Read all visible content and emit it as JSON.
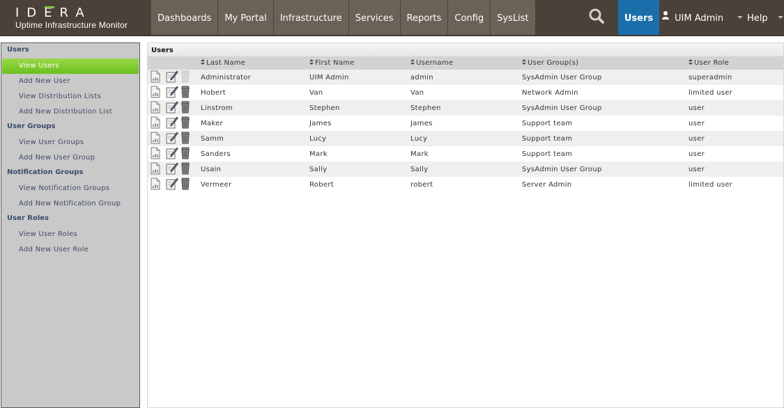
{
  "brand": {
    "logo": "IDERA",
    "subtitle": "Uptime Infrastructure Monitor"
  },
  "nav": [
    {
      "label": "Dashboards"
    },
    {
      "label": "My Portal"
    },
    {
      "label": "Infrastructure"
    },
    {
      "label": "Services"
    },
    {
      "label": "Reports"
    },
    {
      "label": "Config"
    },
    {
      "label": "SysList"
    }
  ],
  "header": {
    "search_icon": "search-icon",
    "users_label": "Users",
    "user_label": "UIM Admin",
    "help_label": "Help"
  },
  "sidebar": {
    "sections": [
      {
        "title": "Users",
        "items": [
          "View Users",
          "Add New User",
          "View Distribution Lists",
          "Add New Distribution List"
        ]
      },
      {
        "title": "User Groups",
        "items": [
          "View User Groups",
          "Add New User Group"
        ]
      },
      {
        "title": "Notification Groups",
        "items": [
          "View Notification Groups",
          "Add New Notification Group"
        ]
      },
      {
        "title": "User Roles",
        "items": [
          "View User Roles",
          "Add New User Role"
        ]
      }
    ],
    "active_item": "View Users"
  },
  "main": {
    "title": "Users",
    "columns": [
      "Last Name",
      "First Name",
      "Username",
      "User Group(s)",
      "User Role"
    ],
    "rows": [
      {
        "last": "Administrator",
        "first": "UIM Admin",
        "username": "admin",
        "group": "SysAdmin User Group",
        "role": "superadmin",
        "deletable": false
      },
      {
        "last": "Hobert",
        "first": "Van",
        "username": "Van",
        "group": "Network Admin",
        "role": "limited user",
        "deletable": true
      },
      {
        "last": "Linstrom",
        "first": "Stephen",
        "username": "Stephen",
        "group": "SysAdmin User Group",
        "role": "user",
        "deletable": true
      },
      {
        "last": "Maker",
        "first": "James",
        "username": "James",
        "group": "Support team",
        "role": "user",
        "deletable": true
      },
      {
        "last": "Samm",
        "first": "Lucy",
        "username": "Lucy",
        "group": "Support team",
        "role": "user",
        "deletable": true
      },
      {
        "last": "Sanders",
        "first": "Mark",
        "username": "Mark",
        "group": "Support team",
        "role": "user",
        "deletable": true
      },
      {
        "last": "Usain",
        "first": "Sally",
        "username": "Sally",
        "group": "SysAdmin User Group",
        "role": "user",
        "deletable": true
      },
      {
        "last": "Vermeer",
        "first": "Robert",
        "username": "robert",
        "group": "Server Admin",
        "role": "limited user",
        "deletable": true
      }
    ]
  },
  "colors": {
    "topbar": "#4a4138",
    "nav_item": "#6b6157",
    "users_active": "#1a6faa",
    "sidebar_active": "#7cc52a",
    "brand_accent": "#8dc63f"
  }
}
